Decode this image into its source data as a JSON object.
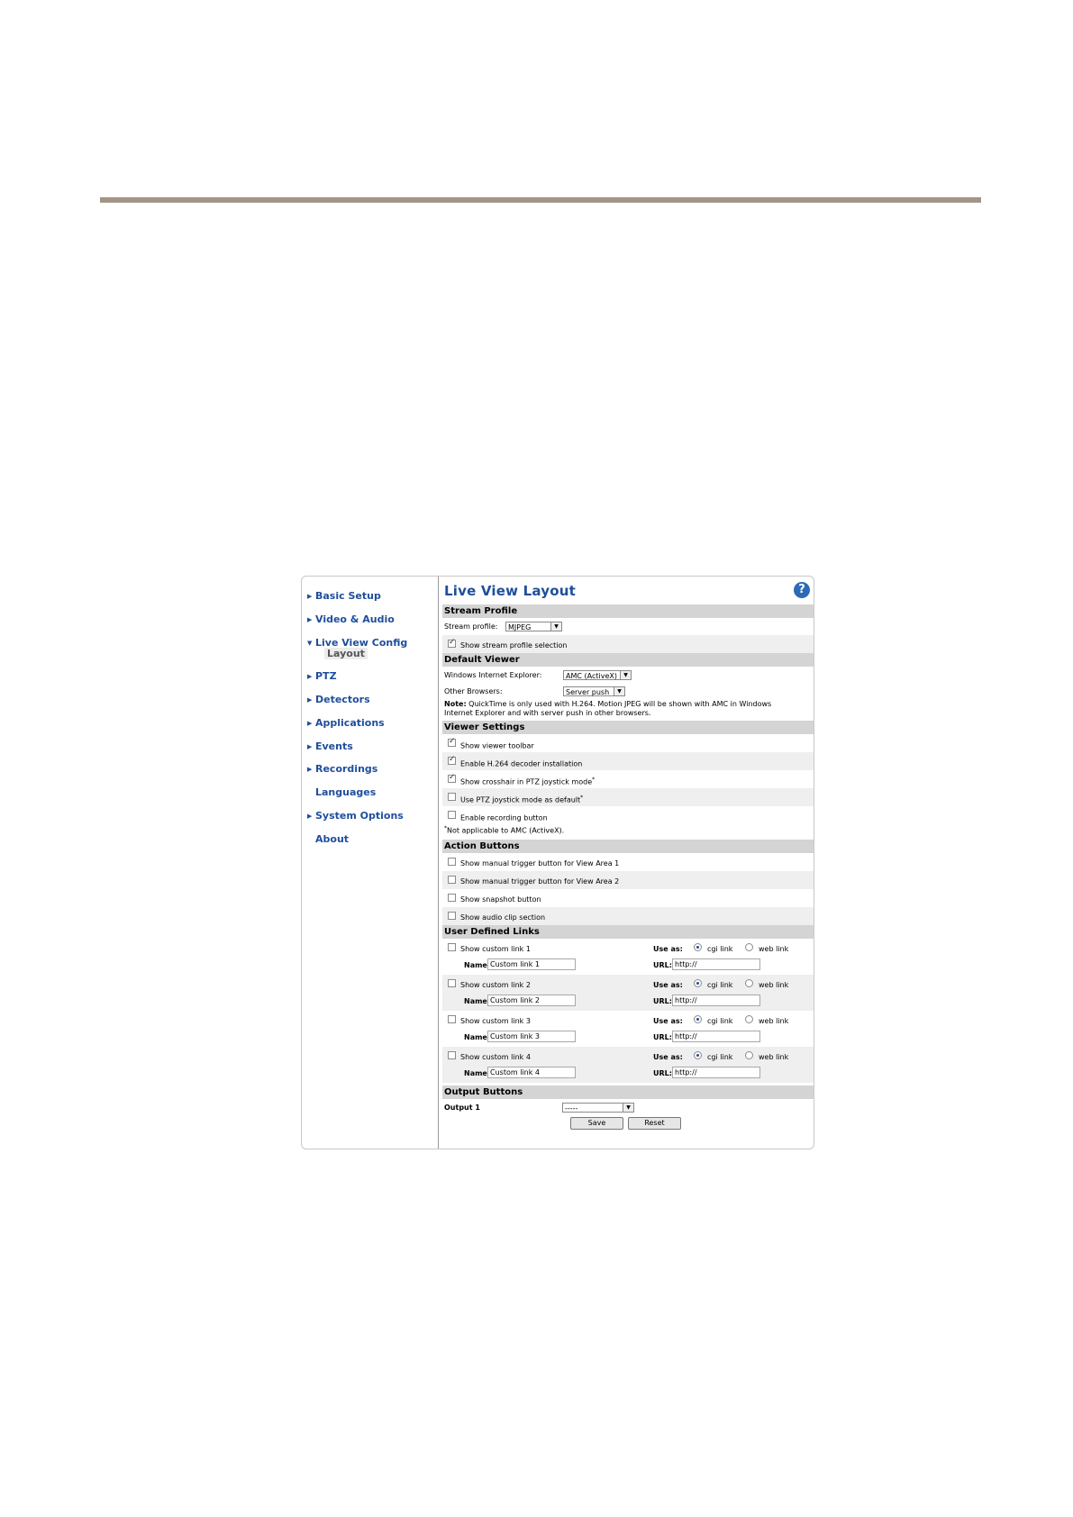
{
  "nav": {
    "items": [
      {
        "label": "Basic Setup"
      },
      {
        "label": "Video & Audio"
      },
      {
        "label": "Live View Config"
      },
      {
        "label": "PTZ"
      },
      {
        "label": "Detectors"
      },
      {
        "label": "Applications"
      },
      {
        "label": "Events"
      },
      {
        "label": "Recordings"
      },
      {
        "label": "Languages"
      },
      {
        "label": "System Options"
      },
      {
        "label": "About"
      }
    ],
    "sub_item": "Layout"
  },
  "main": {
    "title": "Live View Layout",
    "help_icon": "?",
    "stream_profile": {
      "header": "Stream Profile",
      "label": "Stream profile:",
      "value": "MJPEG",
      "show_selection_label": "Show stream profile selection",
      "show_selection_checked": true
    },
    "default_viewer": {
      "header": "Default Viewer",
      "ie_label": "Windows Internet Explorer:",
      "ie_value": "AMC (ActiveX)",
      "other_label": "Other Browsers:",
      "other_value": "Server push",
      "note_bold": "Note:",
      "note_text": " QuickTime is only used with H.264. Motion JPEG will be shown with AMC in Windows Internet Explorer and with server push in other browsers."
    },
    "viewer_settings": {
      "header": "Viewer Settings",
      "items": [
        {
          "label": "Show viewer toolbar",
          "checked": true,
          "star": ""
        },
        {
          "label": "Enable H.264 decoder installation",
          "checked": true,
          "star": ""
        },
        {
          "label": "Show crosshair in PTZ joystick mode",
          "checked": true,
          "star": "*"
        },
        {
          "label": "Use PTZ joystick mode as default",
          "checked": false,
          "star": "*"
        },
        {
          "label": "Enable recording button",
          "checked": false,
          "star": ""
        }
      ],
      "footnote_star": "*",
      "footnote": "Not applicable to AMC (ActiveX)."
    },
    "action_buttons": {
      "header": "Action Buttons",
      "items": [
        {
          "label": "Show manual trigger button for View Area 1"
        },
        {
          "label": "Show manual trigger button for View Area 2"
        },
        {
          "label": "Show snapshot button"
        },
        {
          "label": "Show audio clip section"
        }
      ]
    },
    "user_links": {
      "header": "User Defined Links",
      "use_as_label": "Use as:",
      "cgi_label": "cgi link",
      "web_label": "web link",
      "name_label": "Name:",
      "url_label": "URL:",
      "links": [
        {
          "label": "Show custom link 1",
          "name": "Custom link 1",
          "url": "http://"
        },
        {
          "label": "Show custom link 2",
          "name": "Custom link 2",
          "url": "http://"
        },
        {
          "label": "Show custom link 3",
          "name": "Custom link 3",
          "url": "http://"
        },
        {
          "label": "Show custom link 4",
          "name": "Custom link 4",
          "url": "http://"
        }
      ]
    },
    "output_buttons": {
      "header": "Output Buttons",
      "output_label": "Output 1",
      "output_value": "-----"
    },
    "save_label": "Save",
    "reset_label": "Reset"
  }
}
